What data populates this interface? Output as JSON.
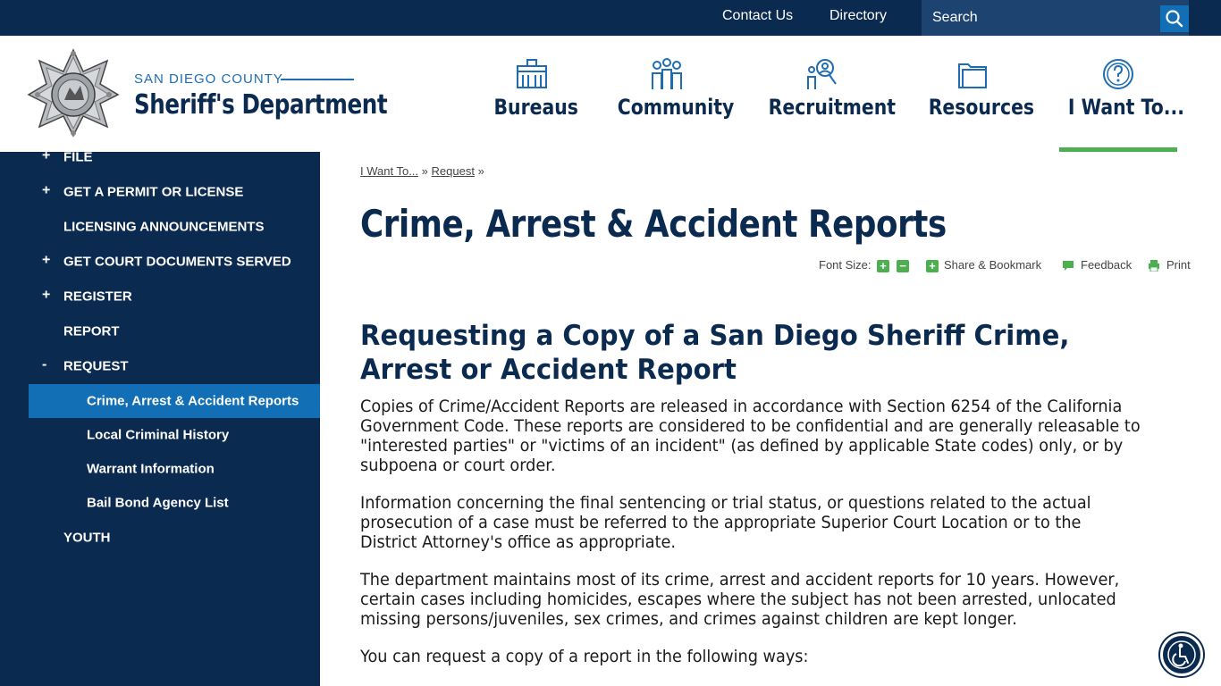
{
  "topbar": {
    "contact_label": "Contact Us",
    "directory_label": "Directory",
    "search_placeholder": "Search"
  },
  "logo": {
    "county": "SAN DIEGO COUNTY",
    "department": "Sheriff's Department"
  },
  "nav": {
    "items": [
      {
        "label": "Bureaus",
        "icon": "building-icon"
      },
      {
        "label": "Community",
        "icon": "people-icon"
      },
      {
        "label": "Recruitment",
        "icon": "recruit-search-icon"
      },
      {
        "label": "Resources",
        "icon": "folder-icon"
      },
      {
        "label": "I Want To...",
        "icon": "question-icon"
      }
    ],
    "active": "I Want To..."
  },
  "sidebar": {
    "items": [
      {
        "label": "FILE",
        "toggle": "+"
      },
      {
        "label": "GET A PERMIT OR LICENSE",
        "toggle": "+"
      },
      {
        "label": "LICENSING ANNOUNCEMENTS",
        "toggle": ""
      },
      {
        "label": "GET COURT DOCUMENTS SERVED",
        "toggle": "+"
      },
      {
        "label": "REGISTER",
        "toggle": "+"
      },
      {
        "label": "REPORT",
        "toggle": ""
      },
      {
        "label": "REQUEST",
        "toggle": "-"
      }
    ],
    "sub_items": [
      {
        "label": "Crime, Arrest & Accident Reports",
        "active": true
      },
      {
        "label": "Local Criminal History",
        "active": false
      },
      {
        "label": "Warrant Information",
        "active": false
      },
      {
        "label": "Bail Bond Agency List",
        "active": false
      }
    ],
    "last_item": {
      "label": "YOUTH"
    }
  },
  "breadcrumb": {
    "items": [
      "I Want To...",
      "Request"
    ],
    "separator": "»"
  },
  "page": {
    "title": "Crime, Arrest & Accident Reports"
  },
  "tools": {
    "font_size_label": "Font Size:",
    "share_label": "Share & Bookmark",
    "feedback_label": "Feedback",
    "print_label": "Print"
  },
  "content": {
    "heading": "Requesting a Copy of a San Diego Sheriff Crime, Arrest or Accident Report",
    "paragraphs": [
      "Copies of Crime/Accident Reports are released in accordance with Section 6254 of the California Government Code. These reports are considered to be confidential and are generally releasable to \"interested parties\" or \"victims of an incident\" (as defined by applicable State codes) only, or by subpoena or court order.",
      "Information concerning the final sentencing or trial status, or questions related to the actual prosecution of a case must be referred to the appropriate Superior Court Location or to the District Attorney's office as appropriate.",
      "The department maintains most of its crime, arrest and accident reports for 10 years. However, certain cases including homicides, escapes where the subject has not been arrested, unlocated missing persons/juveniles, sex crimes, and crimes against children are kept longer.",
      "You can request a copy of a report in the following ways:"
    ]
  },
  "colors": {
    "navy": "#0b2a50",
    "blue": "#136fb5",
    "green": "#4caf50"
  }
}
